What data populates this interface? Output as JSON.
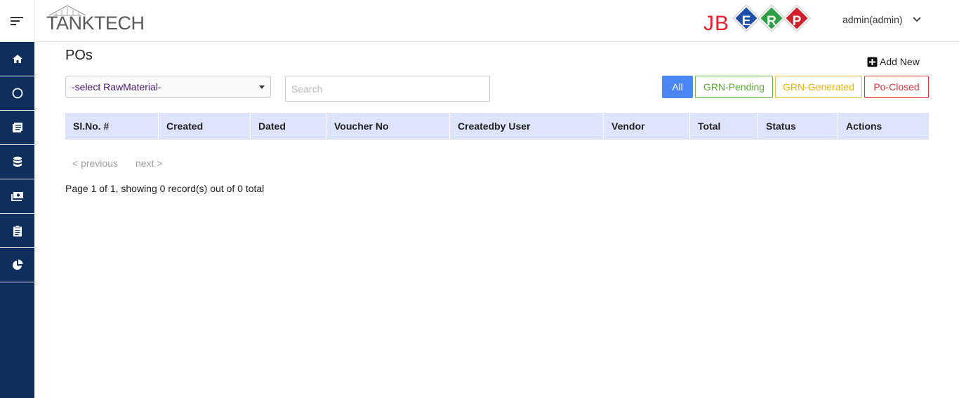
{
  "header": {
    "brand": "TANKTECH",
    "erp_logo": {
      "jb": "JB",
      "letters": [
        "E",
        "R",
        "P"
      ],
      "colors": [
        "#1e4fa8",
        "#2f9e44",
        "#d0202c"
      ]
    },
    "user_label": "admin(admin)"
  },
  "sidebar": {
    "items": [
      {
        "icon": "home-icon"
      },
      {
        "icon": "circle-icon"
      },
      {
        "icon": "book-icon"
      },
      {
        "icon": "database-icon"
      },
      {
        "icon": "money-icon"
      },
      {
        "icon": "clipboard-icon"
      },
      {
        "icon": "pie-chart-icon"
      }
    ]
  },
  "page": {
    "title": "POs",
    "add_new": "Add New"
  },
  "filters": {
    "select_value": "-select RawMaterial-",
    "search_placeholder": "Search",
    "tabs": [
      "All",
      "GRN-Pending",
      "GRN-Generated",
      "Po-Closed"
    ],
    "active_tab": "All"
  },
  "table": {
    "columns": [
      "Sl.No. #",
      "Created",
      "Dated",
      "Voucher No",
      "Createdby User",
      "Vendor",
      "Total",
      "Status",
      "Actions"
    ],
    "rows": []
  },
  "pagination": {
    "previous": "< previous",
    "next": "next >",
    "info": "Page 1 of 1, showing 0 record(s) out of 0 total"
  },
  "colors": {
    "sidebar_bg": "#0e2f5b",
    "table_header_bg": "#dde4fb",
    "active_tab": "#4b86f5"
  }
}
